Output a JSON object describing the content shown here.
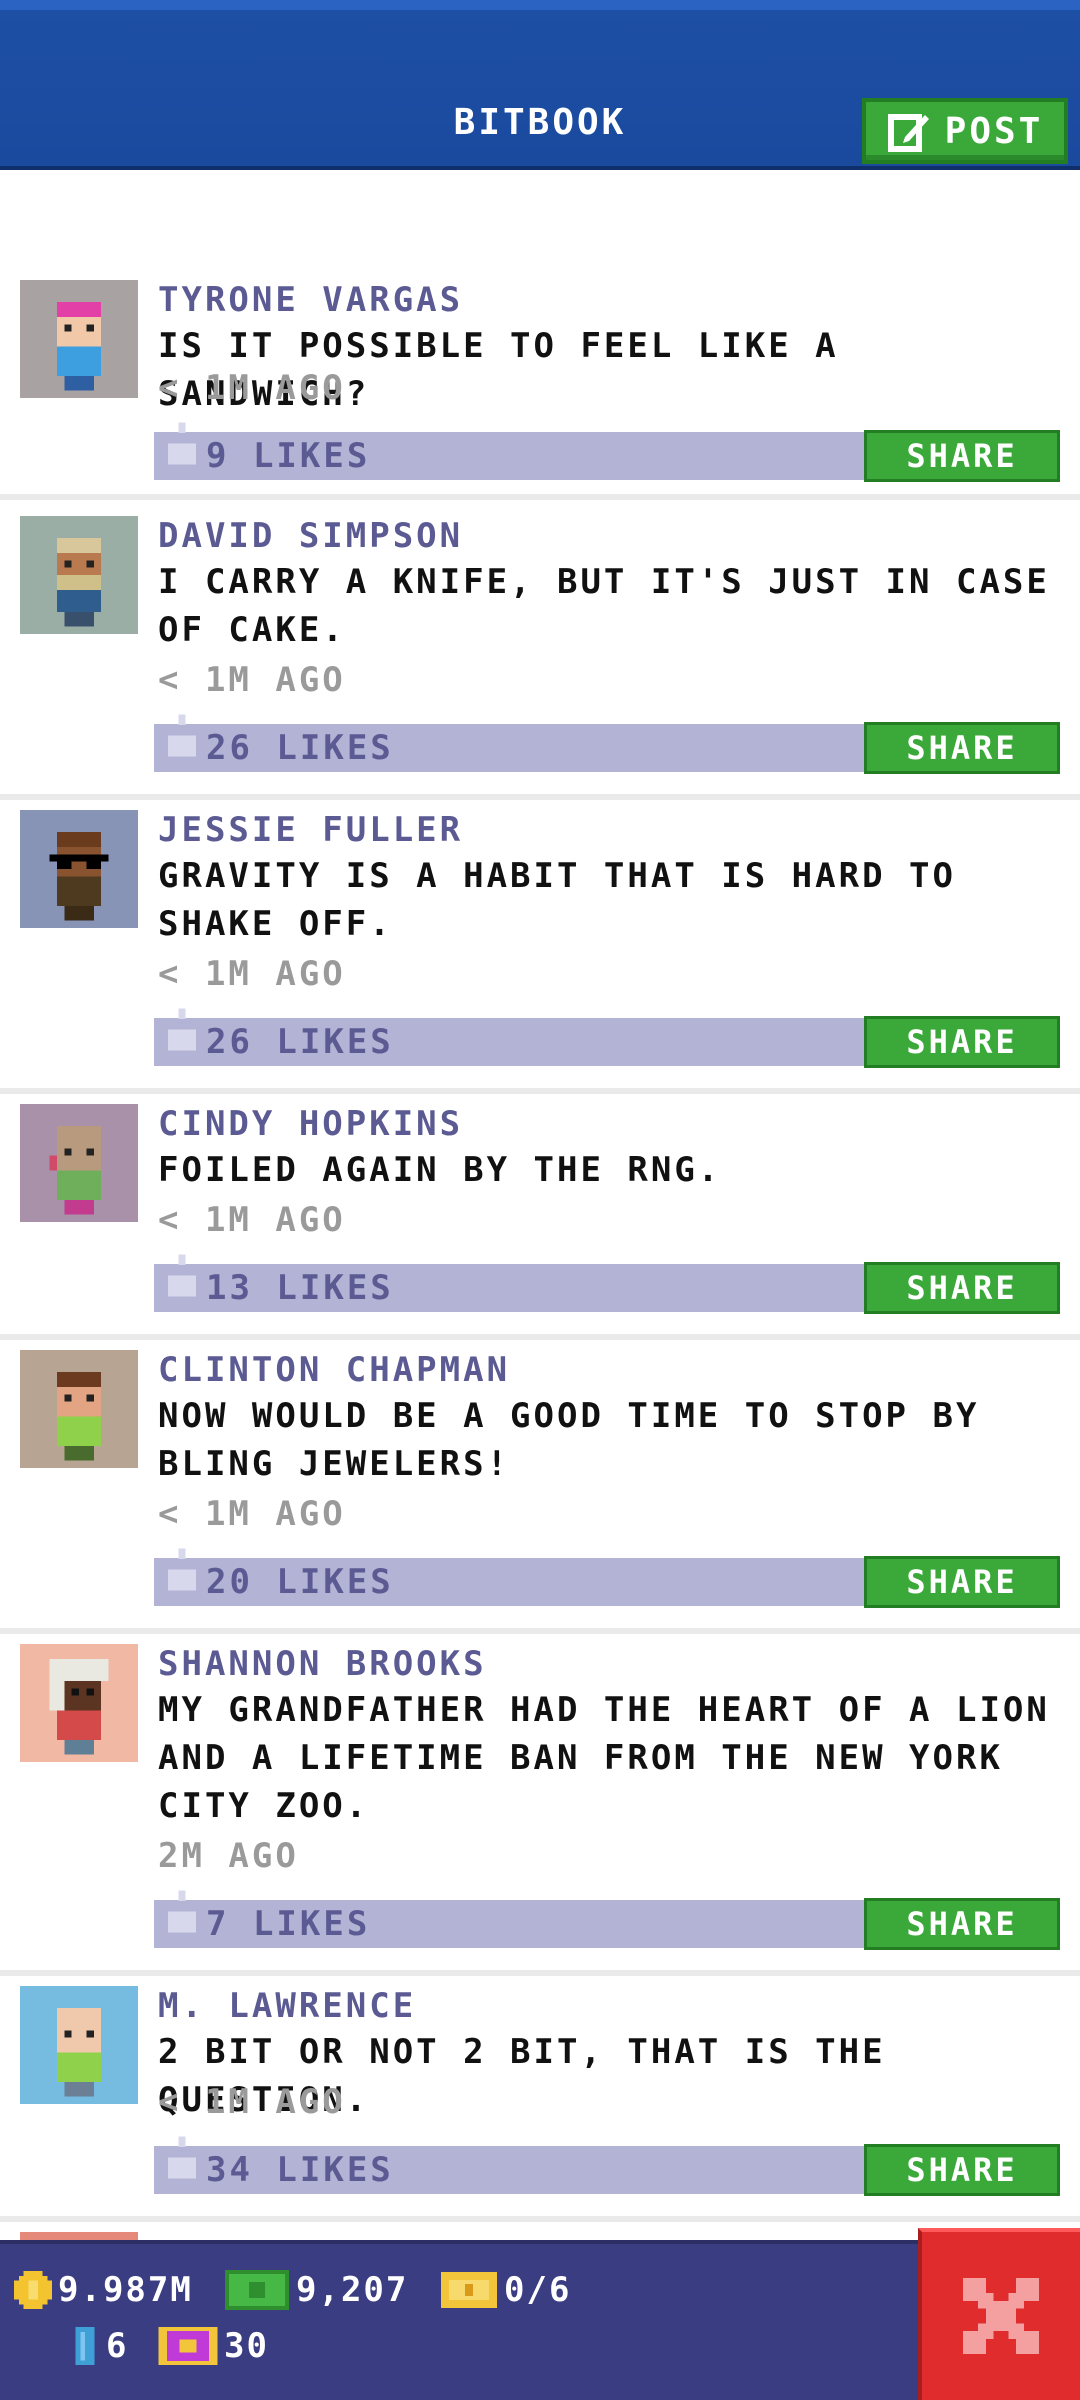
{
  "header": {
    "title": "BITBOOK",
    "post_label": "POST"
  },
  "feed": {
    "share_label": "SHARE",
    "posts": [
      {
        "author": "TYRONE VARGAS",
        "text": "IS IT POSSIBLE TO FEEL LIKE A SANDWICH?",
        "time": "< 1M AGO",
        "likes": "9 LIKES",
        "avatar": "pink-hair-person"
      },
      {
        "author": "DAVID SIMPSON",
        "text": "I CARRY A KNIFE, BUT IT'S JUST IN CASE OF CAKE.",
        "time": "< 1M AGO",
        "likes": "26 LIKES",
        "avatar": "bearded-person"
      },
      {
        "author": "JESSIE FULLER",
        "text": "GRAVITY IS A HABIT THAT IS HARD TO SHAKE OFF.",
        "time": "< 1M AGO",
        "likes": "26 LIKES",
        "avatar": "sunglasses-person"
      },
      {
        "author": "CINDY HOPKINS",
        "text": "FOILED AGAIN BY THE RNG.",
        "time": "< 1M AGO",
        "likes": "13 LIKES",
        "avatar": "bald-person"
      },
      {
        "author": "CLINTON CHAPMAN",
        "text": "NOW WOULD BE A GOOD TIME TO STOP BY BLING JEWELERS!",
        "time": "< 1M AGO",
        "likes": "20 LIKES",
        "avatar": "brown-hair-person"
      },
      {
        "author": "SHANNON BROOKS",
        "text": "MY GRANDFATHER HAD THE HEART OF A LION AND A LIFETIME BAN FROM THE NEW YORK CITY ZOO.",
        "time": "2M AGO",
        "likes": "7 LIKES",
        "avatar": "white-hair-person"
      },
      {
        "author": "M. LAWRENCE",
        "text": "2 BIT OR NOT 2 BIT, THAT IS THE QUESTION.",
        "time": "< 1M AGO",
        "likes": "34 LIKES",
        "avatar": "bald-light-person"
      }
    ]
  },
  "bottom": {
    "coins": "9.987M",
    "bux": "9,207",
    "tickets": "0/6",
    "keys": "6",
    "vip": "30"
  },
  "colors": {
    "header": "#1d4fa5",
    "green": "#3aa93a",
    "purple_text": "#5b5a93",
    "likes_bar": "#b3b3d5",
    "bottom_bar": "#3b3d82",
    "close_red": "#e02c2c"
  }
}
